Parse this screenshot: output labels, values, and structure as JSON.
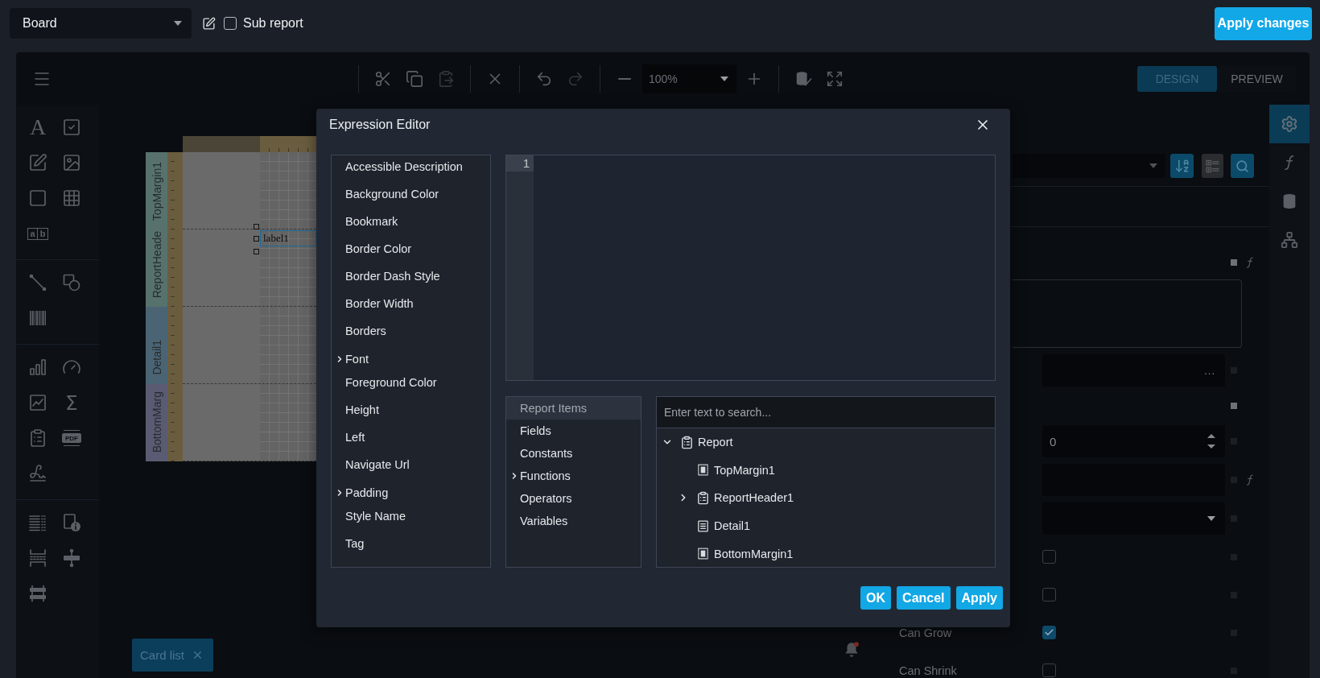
{
  "top_bar": {
    "report_select": {
      "value": "Board"
    },
    "sub_report": {
      "label": "Sub report",
      "checked": false
    },
    "apply_button": {
      "label": "Apply changes"
    }
  },
  "designer_toolbar": {
    "tool_groups": [
      {
        "buttons": [
          {
            "kind": "cut",
            "disabled": false
          },
          {
            "kind": "copy",
            "disabled": false
          },
          {
            "kind": "paste",
            "disabled": true
          }
        ]
      },
      {
        "buttons": [
          {
            "kind": "delete",
            "disabled": false
          }
        ]
      },
      {
        "buttons": [
          {
            "kind": "undo",
            "disabled": false
          },
          {
            "kind": "redo",
            "disabled": true
          }
        ]
      },
      {
        "buttons": [
          {
            "kind": "zoom-out",
            "disabled": false
          },
          {
            "kind": "zoom-select",
            "value": "100%"
          },
          {
            "kind": "zoom-in",
            "disabled": false
          }
        ]
      },
      {
        "buttons": [
          {
            "kind": "validate",
            "disabled": false
          },
          {
            "kind": "full-screen",
            "disabled": false
          }
        ]
      }
    ],
    "view_tabs": [
      {
        "label": "DESIGN",
        "selected": true
      },
      {
        "label": "PREVIEW",
        "selected": false
      }
    ]
  },
  "toolbox": [
    {
      "tools": [
        {
          "kind": "label",
          "glyph": "A"
        },
        {
          "kind": "check-box"
        },
        {
          "kind": "rich-text"
        },
        {
          "kind": "picture-box"
        },
        {
          "kind": "panel"
        },
        {
          "kind": "table"
        },
        {
          "kind": "character-comb",
          "glyphs": [
            "a",
            "b"
          ]
        }
      ]
    },
    {
      "tools": [
        {
          "kind": "line"
        },
        {
          "kind": "shape"
        },
        {
          "kind": "barcode"
        }
      ]
    },
    {
      "tools": [
        {
          "kind": "chart"
        },
        {
          "kind": "gauge"
        },
        {
          "kind": "sparkline"
        },
        {
          "kind": "summary",
          "glyph": "Σ"
        },
        {
          "kind": "subreport"
        },
        {
          "kind": "pdf-content",
          "glyph": "PDF"
        },
        {
          "kind": "pdf-signature"
        }
      ]
    },
    {
      "tools": [
        {
          "kind": "table-of-contents"
        },
        {
          "kind": "page-info"
        },
        {
          "kind": "page-break"
        },
        {
          "kind": "cross-band-line"
        },
        {
          "kind": "cross-band-box"
        }
      ]
    }
  ],
  "report": {
    "bands": [
      {
        "name": "TopMargin1",
        "color": "#57726d"
      },
      {
        "name": "ReportHeade",
        "color": "#57726d",
        "controls": [
          {
            "text": "label1",
            "selected": true
          }
        ]
      },
      {
        "name": "Detail1",
        "color": "#4b6474"
      },
      {
        "name": "BottomMarg",
        "color": "#5a5b73"
      }
    ]
  },
  "report_tabs": [
    {
      "label": "Card list",
      "selected": true
    }
  ],
  "notifications": {
    "unread": true
  },
  "properties_panel": {
    "sort_alphabetically": {
      "selected": true
    },
    "categorize": {
      "selected": false
    },
    "rows": [
      {
        "kind": "textarea",
        "modified": true,
        "expression": true
      },
      {
        "kind": "ellipsis",
        "button_text": "...",
        "modified": false,
        "expression": false
      },
      {
        "kind": "group",
        "modified": true,
        "expression": false
      },
      {
        "kind": "number",
        "value": "0",
        "modified": false,
        "expression": false
      },
      {
        "kind": "text",
        "modified": false,
        "expression": true
      },
      {
        "kind": "dropdown",
        "modified": false,
        "expression": false
      },
      {
        "kind": "checkbox",
        "checked": false,
        "modified": false,
        "expression": false
      },
      {
        "kind": "checkbox",
        "checked": false,
        "modified": false,
        "expression": false
      },
      {
        "kind": "checkbox",
        "label": "Can Grow",
        "checked": true,
        "modified": false,
        "expression": false
      },
      {
        "kind": "checkbox",
        "label": "Can Shrink",
        "checked": false,
        "modified": false,
        "expression": false
      }
    ]
  },
  "side_tabs": [
    {
      "kind": "properties",
      "selected": true
    },
    {
      "kind": "expressions",
      "selected": false
    },
    {
      "kind": "field-list",
      "selected": false
    },
    {
      "kind": "report-explorer",
      "selected": false
    }
  ],
  "expression_editor": {
    "title": "Expression Editor",
    "properties": [
      {
        "label": "Accessible Description",
        "kind": "property"
      },
      {
        "label": "Background Color",
        "kind": "property"
      },
      {
        "label": "Bookmark",
        "kind": "property"
      },
      {
        "label": "Border Color",
        "kind": "property"
      },
      {
        "label": "Border Dash Style",
        "kind": "property"
      },
      {
        "label": "Border Width",
        "kind": "property"
      },
      {
        "label": "Borders",
        "kind": "property"
      },
      {
        "label": "Font",
        "kind": "group",
        "expanded": false
      },
      {
        "label": "Foreground Color",
        "kind": "property"
      },
      {
        "label": "Height",
        "kind": "property"
      },
      {
        "label": "Left",
        "kind": "property"
      },
      {
        "label": "Navigate Url",
        "kind": "property"
      },
      {
        "label": "Padding",
        "kind": "group",
        "expanded": false
      },
      {
        "label": "Style Name",
        "kind": "property"
      },
      {
        "label": "Tag",
        "kind": "property"
      }
    ],
    "code": {
      "line_numbers": [
        "1"
      ]
    },
    "categories": [
      {
        "label": "Report Items",
        "kind": "category",
        "selected": true
      },
      {
        "label": "Fields",
        "kind": "category",
        "selected": false
      },
      {
        "label": "Constants",
        "kind": "category",
        "selected": false
      },
      {
        "label": "Functions",
        "kind": "group",
        "expanded": false,
        "selected": false
      },
      {
        "label": "Operators",
        "kind": "category",
        "selected": false
      },
      {
        "label": "Variables",
        "kind": "category",
        "selected": false
      }
    ],
    "search": {
      "placeholder": "Enter text to search..."
    },
    "tree": [
      {
        "label": "Report",
        "kind": "report",
        "expanded": true,
        "children": [
          {
            "label": "TopMargin1",
            "kind": "margin-band"
          },
          {
            "label": "ReportHeader1",
            "kind": "header-band",
            "expanded": false
          },
          {
            "label": "Detail1",
            "kind": "detail-band"
          },
          {
            "label": "BottomMargin1",
            "kind": "margin-band"
          }
        ]
      }
    ],
    "buttons": [
      {
        "label": "OK"
      },
      {
        "label": "Cancel"
      },
      {
        "label": "Apply"
      }
    ]
  }
}
